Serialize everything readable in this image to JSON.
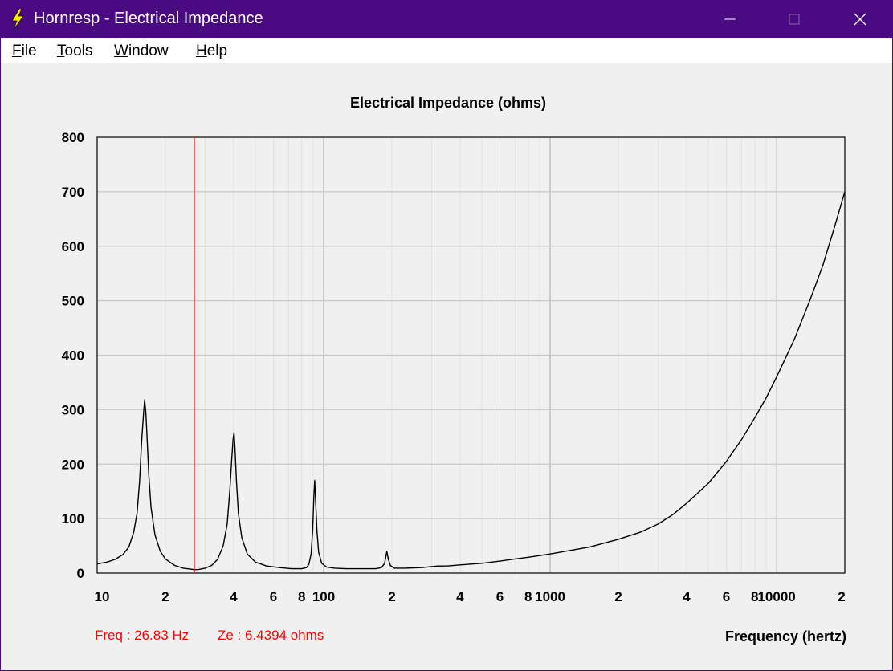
{
  "window": {
    "title": "Hornresp - Electrical Impedance",
    "minimize_glyph": "─",
    "maximize_glyph": "☐",
    "close_glyph": "✕",
    "title_bg": "#4a0a82"
  },
  "menu": {
    "items": [
      {
        "accel": "F",
        "rest": "ile"
      },
      {
        "accel": "T",
        "rest": "ools"
      },
      {
        "accel": "W",
        "rest": "indow"
      },
      {
        "accel": "H",
        "rest": "elp"
      }
    ]
  },
  "readout": {
    "freq": "Freq : 26.83 Hz",
    "ze": "Ze : 6.4394 ohms",
    "color": "#ff0000"
  },
  "chart_data": {
    "type": "line",
    "title": "Electrical Impedance (ohms)",
    "xlabel": "Frequency (hertz)",
    "ylabel": "",
    "x_scale": "log",
    "xlim": [
      10,
      20000
    ],
    "ylim": [
      0,
      800
    ],
    "grid": true,
    "x_ticks": [
      {
        "value": 10,
        "label": "10"
      },
      {
        "value": 20,
        "label": "2"
      },
      {
        "value": 40,
        "label": "4"
      },
      {
        "value": 60,
        "label": "6"
      },
      {
        "value": 80,
        "label": "8"
      },
      {
        "value": 100,
        "label": "100"
      },
      {
        "value": 200,
        "label": "2"
      },
      {
        "value": 400,
        "label": "4"
      },
      {
        "value": 600,
        "label": "6"
      },
      {
        "value": 800,
        "label": "8"
      },
      {
        "value": 1000,
        "label": "1000"
      },
      {
        "value": 2000,
        "label": "2"
      },
      {
        "value": 4000,
        "label": "4"
      },
      {
        "value": 6000,
        "label": "6"
      },
      {
        "value": 8000,
        "label": "8"
      },
      {
        "value": 10000,
        "label": "10000"
      },
      {
        "value": 20000,
        "label": "2"
      }
    ],
    "y_ticks": [
      0,
      100,
      200,
      300,
      400,
      500,
      600,
      700,
      800
    ],
    "cursor": {
      "x": 26.83,
      "color": "#ff0000"
    },
    "series": [
      {
        "color": "#000000",
        "points": [
          [
            10,
            17
          ],
          [
            11,
            20
          ],
          [
            12,
            25
          ],
          [
            13,
            34
          ],
          [
            13.8,
            48
          ],
          [
            14.5,
            75
          ],
          [
            15,
            110
          ],
          [
            15.4,
            170
          ],
          [
            15.7,
            240
          ],
          [
            16,
            290
          ],
          [
            16.2,
            318
          ],
          [
            16.4,
            295
          ],
          [
            16.6,
            250
          ],
          [
            16.9,
            180
          ],
          [
            17.3,
            120
          ],
          [
            18,
            70
          ],
          [
            19,
            40
          ],
          [
            20,
            26
          ],
          [
            22,
            14
          ],
          [
            24,
            9
          ],
          [
            26.83,
            6.4
          ],
          [
            28,
            6.5
          ],
          [
            30,
            9
          ],
          [
            32,
            14
          ],
          [
            34,
            25
          ],
          [
            36,
            50
          ],
          [
            37.5,
            90
          ],
          [
            38.5,
            150
          ],
          [
            39.3,
            210
          ],
          [
            39.8,
            245
          ],
          [
            40.2,
            258
          ],
          [
            40.6,
            230
          ],
          [
            41.2,
            170
          ],
          [
            42,
            110
          ],
          [
            43.5,
            65
          ],
          [
            46,
            35
          ],
          [
            50,
            20
          ],
          [
            56,
            13
          ],
          [
            64,
            10
          ],
          [
            72,
            8
          ],
          [
            80,
            8
          ],
          [
            84,
            10
          ],
          [
            86,
            16
          ],
          [
            88,
            35
          ],
          [
            89.5,
            80
          ],
          [
            90.5,
            140
          ],
          [
            91.3,
            170
          ],
          [
            92.2,
            130
          ],
          [
            93.5,
            75
          ],
          [
            95,
            38
          ],
          [
            98,
            18
          ],
          [
            103,
            11
          ],
          [
            112,
            9
          ],
          [
            125,
            8
          ],
          [
            150,
            8
          ],
          [
            170,
            8
          ],
          [
            180,
            10
          ],
          [
            186,
            18
          ],
          [
            190,
            40
          ],
          [
            193,
            25
          ],
          [
            197,
            14
          ],
          [
            205,
            9
          ],
          [
            230,
            9
          ],
          [
            270,
            10
          ],
          [
            300,
            12
          ],
          [
            320,
            13
          ],
          [
            350,
            13
          ],
          [
            400,
            15
          ],
          [
            500,
            18
          ],
          [
            600,
            22
          ],
          [
            700,
            26
          ],
          [
            800,
            29
          ],
          [
            1000,
            35
          ],
          [
            1500,
            48
          ],
          [
            2000,
            62
          ],
          [
            2500,
            75
          ],
          [
            3000,
            90
          ],
          [
            3500,
            108
          ],
          [
            4000,
            128
          ],
          [
            5000,
            165
          ],
          [
            6000,
            205
          ],
          [
            7000,
            245
          ],
          [
            8000,
            285
          ],
          [
            9000,
            322
          ],
          [
            10000,
            360
          ],
          [
            12000,
            430
          ],
          [
            14000,
            500
          ],
          [
            16000,
            565
          ],
          [
            18000,
            635
          ],
          [
            20000,
            700
          ]
        ]
      }
    ]
  }
}
